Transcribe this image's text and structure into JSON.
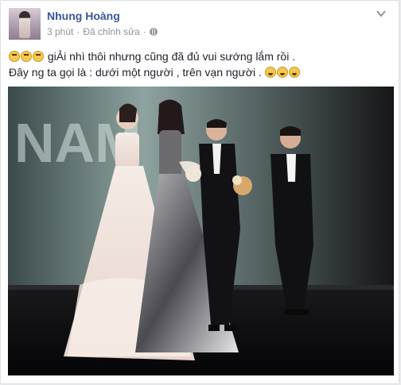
{
  "post": {
    "author_name": "Nhung Hoàng",
    "time": "3 phút",
    "separator": "·",
    "edited": "Đã chỉnh sửa",
    "separator2": "·",
    "line1_text": " giẢi nhì thôi nhưng cũng đã đủ vui sướng lắm rồi .",
    "line2_text": "Đây ng ta gọi là : dưới một người , trên vạn người . ",
    "line1_emoji": [
      "crying-face",
      "crying-face",
      "crying-face"
    ],
    "line2_emoji": [
      "laughing-face",
      "laughing-face",
      "laughing-face"
    ]
  },
  "photo": {
    "description_icon": "photo",
    "backdrop_letters": "NAM"
  },
  "colors": {
    "author_link": "#365899",
    "meta_gray": "#90949c",
    "text": "#1d2129",
    "card_border": "#dddfe2"
  }
}
